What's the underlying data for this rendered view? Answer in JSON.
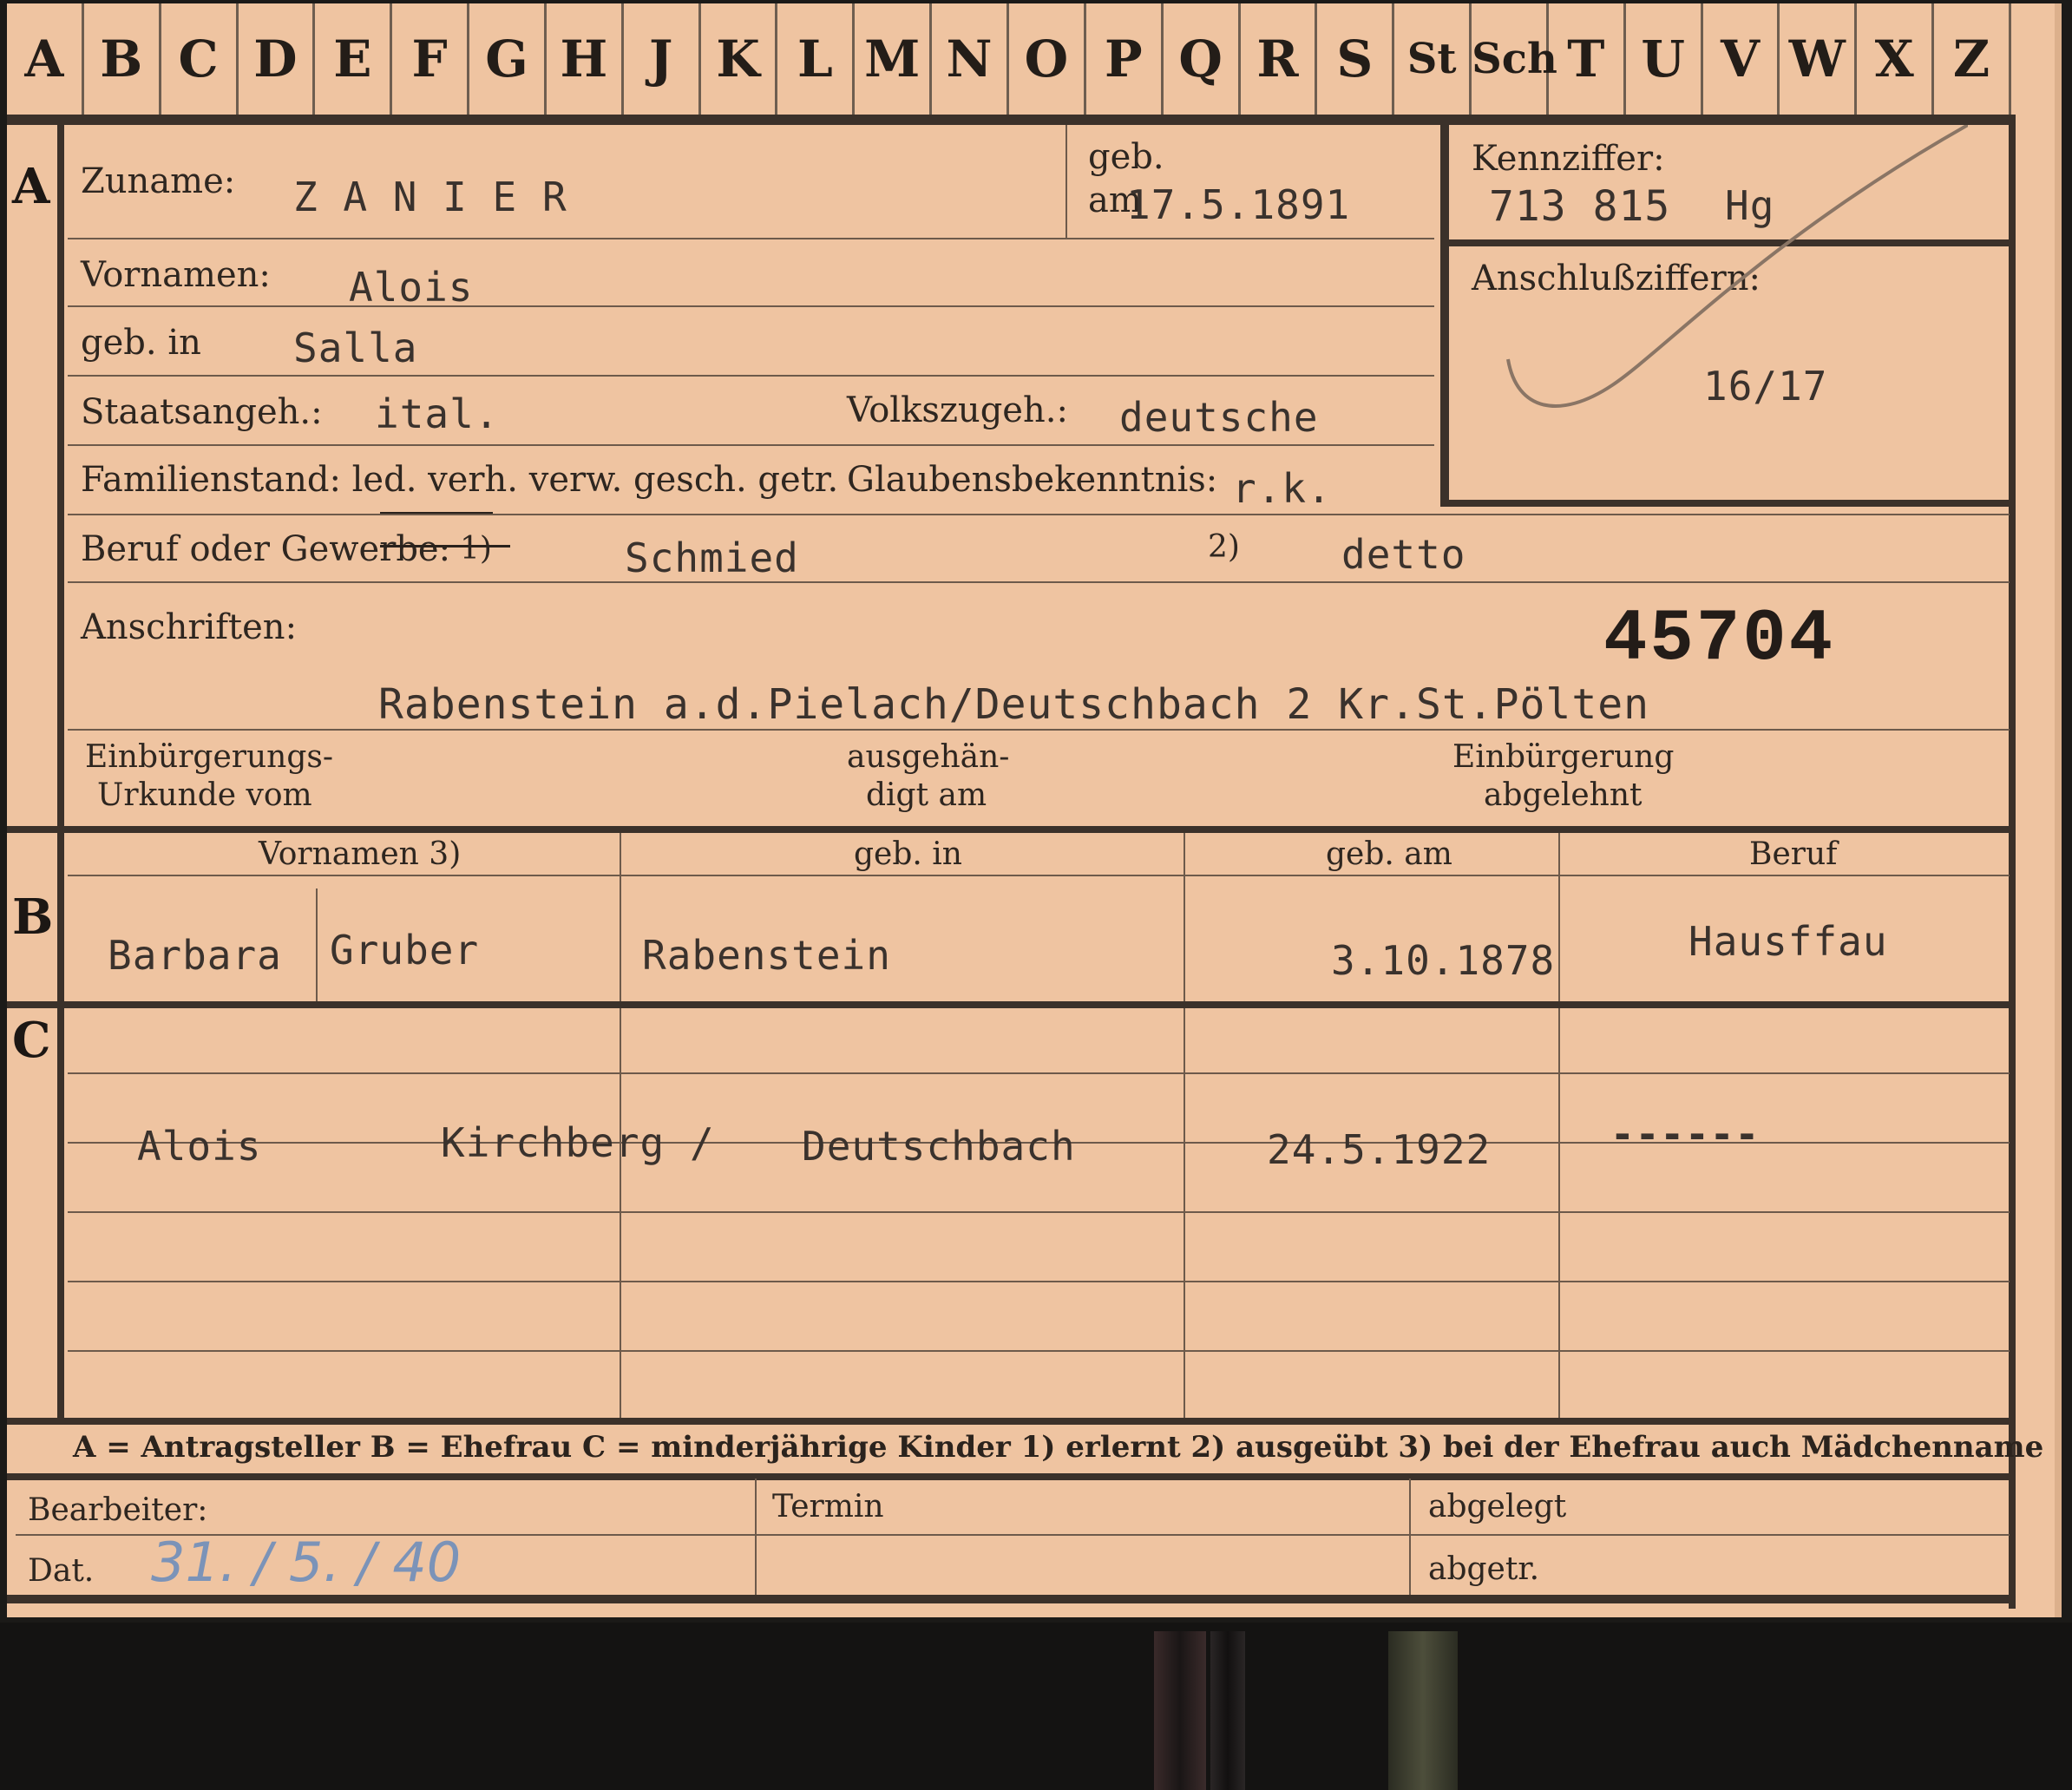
{
  "tabs": [
    "A",
    "B",
    "C",
    "D",
    "E",
    "F",
    "G",
    "H",
    "J",
    "K",
    "L",
    "M",
    "N",
    "O",
    "P",
    "Q",
    "R",
    "S",
    "St",
    "Sch",
    "T",
    "U",
    "V",
    "W",
    "X",
    "Z"
  ],
  "sections": {
    "a": "A",
    "b": "B",
    "c": "C"
  },
  "applicant": {
    "surname_label": "Zuname:",
    "surname": "Z A N I E R",
    "born_label_1": "geb.",
    "born_label_2": "am",
    "born_date": "17.5.1891",
    "first_names_label": "Vornamen:",
    "first_names": "Alois",
    "birthplace_label": "geb. in",
    "birthplace": "Salla",
    "citizenship_label": "Staatsangeh.:",
    "citizenship": "ital.",
    "ethnicity_label": "Volkszugeh.:",
    "ethnicity": "deutsche",
    "marital_label": "Familienstand: led. verh. verw. gesch. getr.",
    "religion_label": "Glaubensbekenntnis:",
    "religion": "r.k.",
    "occupation_label": "Beruf oder Gewerbe:",
    "occupation_fn1": "1)",
    "occupation_learned": "Schmied",
    "occupation_fn2": "2)",
    "occupation_practised": "detto",
    "address_label": "Anschriften:",
    "file_number": "45704",
    "address": "Rabenstein a.d.Pielach/Deutschbach 2 Kr.St.Pölten",
    "naturalization_label_1": "Einbürgerungs-",
    "naturalization_label_2": "Urkunde vom",
    "issued_label_1": "ausgehän-",
    "issued_label_2": "digt am",
    "rejected_label_1": "Einbürgerung",
    "rejected_label_2": "abgelehnt"
  },
  "reference": {
    "label": "Kennziffer:",
    "number": "713 815",
    "code": "Hg",
    "connection_label": "Anschlußziffern:",
    "connection_value": "16/17"
  },
  "wife_table": {
    "headers": {
      "first_names": "Vornamen 3)",
      "birthplace": "geb. in",
      "birth_date": "geb. am",
      "occupation": "Beruf"
    },
    "first_name": "Barbara",
    "maiden_name": "Gruber",
    "birthplace": "Rabenstein",
    "birth_date": "3.10.1878",
    "occupation": "Hausffau"
  },
  "children": [
    {
      "first_name": "Alois",
      "birthplace_1": "Kirchberg /",
      "birthplace_2": "Deutschbach",
      "birth_date": "24.5.1922",
      "occupation": "------"
    }
  ],
  "legend": "A = Antragsteller   B = Ehefrau   C = minderjährige Kinder   1) erlernt   2) ausgeübt   3) bei der Ehefrau auch Mädchenname",
  "footer": {
    "clerk_label": "Bearbeiter:",
    "date_label": "Dat.",
    "date_value": "31. / 5. / 40",
    "deadline_label": "Termin",
    "filed_label": "abgelegt",
    "removed_label": "abgetr."
  }
}
